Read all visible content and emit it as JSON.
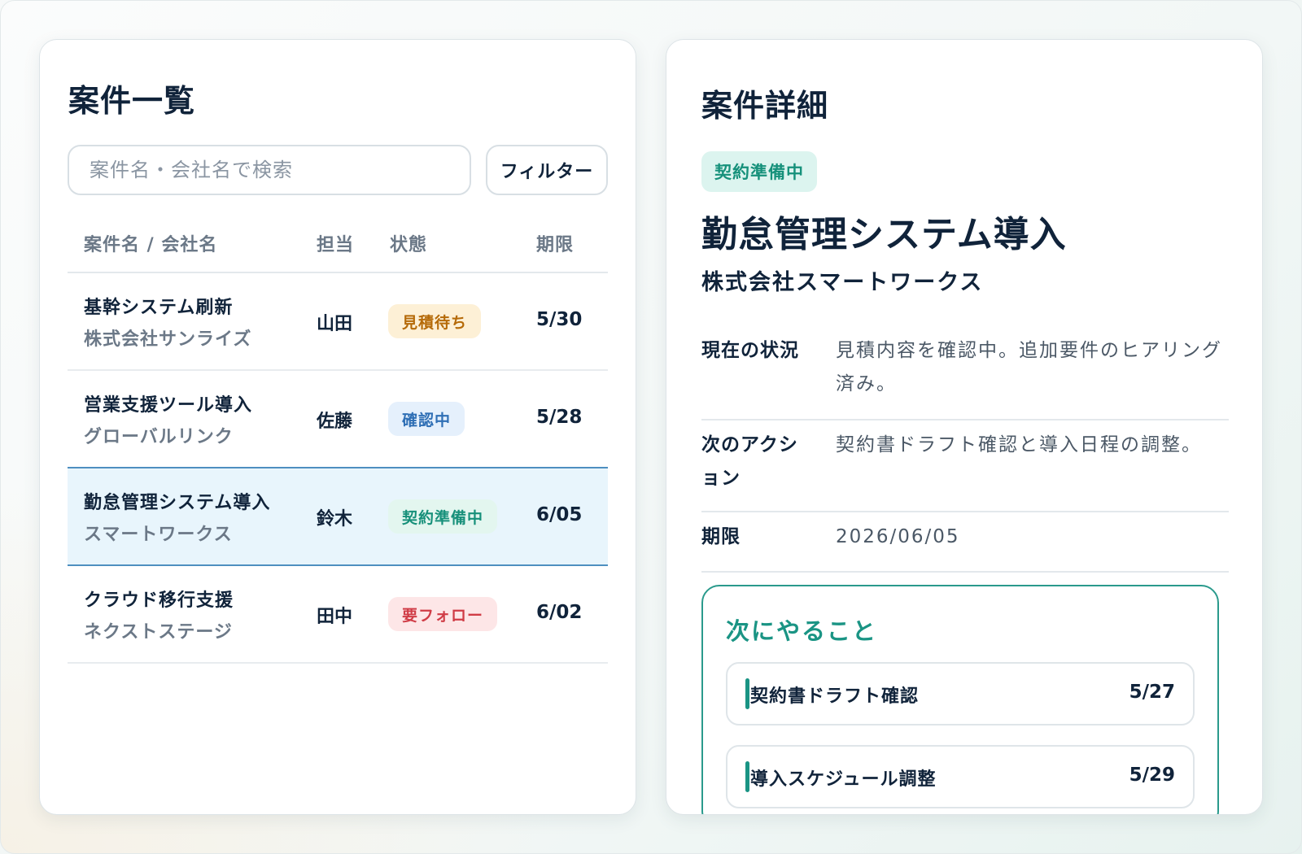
{
  "list": {
    "title": "案件一覧",
    "search_placeholder": "案件名・会社名で検索",
    "filter_label": "フィルター",
    "columns": [
      "案件名 / 会社名",
      "担当",
      "状態",
      "期限"
    ],
    "rows": [
      {
        "project": "基幹システム刷新",
        "company": "株式会社サンライズ",
        "owner": "山田",
        "status": "見積待ち",
        "status_color": "#b56a08",
        "due": "5/30"
      },
      {
        "project": "営業支援ツール導入",
        "company": "グローバルリンク",
        "owner": "佐藤",
        "status": "確認中",
        "status_color": "#2f6fb5",
        "due": "5/28"
      },
      {
        "project": "勤怠管理システム導入",
        "company": "スマートワークス",
        "owner": "鈴木",
        "status": "契約準備中",
        "status_color": "#17907a",
        "due": "6/05",
        "selected": true
      },
      {
        "project": "クラウド移行支援",
        "company": "ネクストステージ",
        "owner": "田中",
        "status": "要フォロー",
        "status_color": "#d03c46",
        "due": "6/02"
      }
    ]
  },
  "detail": {
    "title": "案件詳細",
    "status": "契約準備中",
    "project_name": "勤怠管理システム導入",
    "company_name": "株式会社スマートワークス",
    "info": [
      {
        "label": "現在の状況",
        "value": "見積内容を確認中。追加要件のヒアリング済み。"
      },
      {
        "label": "次のアクション",
        "value": "契約書ドラフト確認と導入日程の調整。"
      },
      {
        "label": "期限",
        "value": "2026/06/05"
      }
    ],
    "todo": {
      "title": "次にやること",
      "items": [
        {
          "label": "契約書ドラフト確認",
          "due": "5/27"
        },
        {
          "label": "導入スケジュール調整",
          "due": "5/29"
        }
      ]
    }
  },
  "colors": {
    "accent": "#1a9484",
    "selected_row": "#e8f5fc",
    "text": "#10233a"
  }
}
